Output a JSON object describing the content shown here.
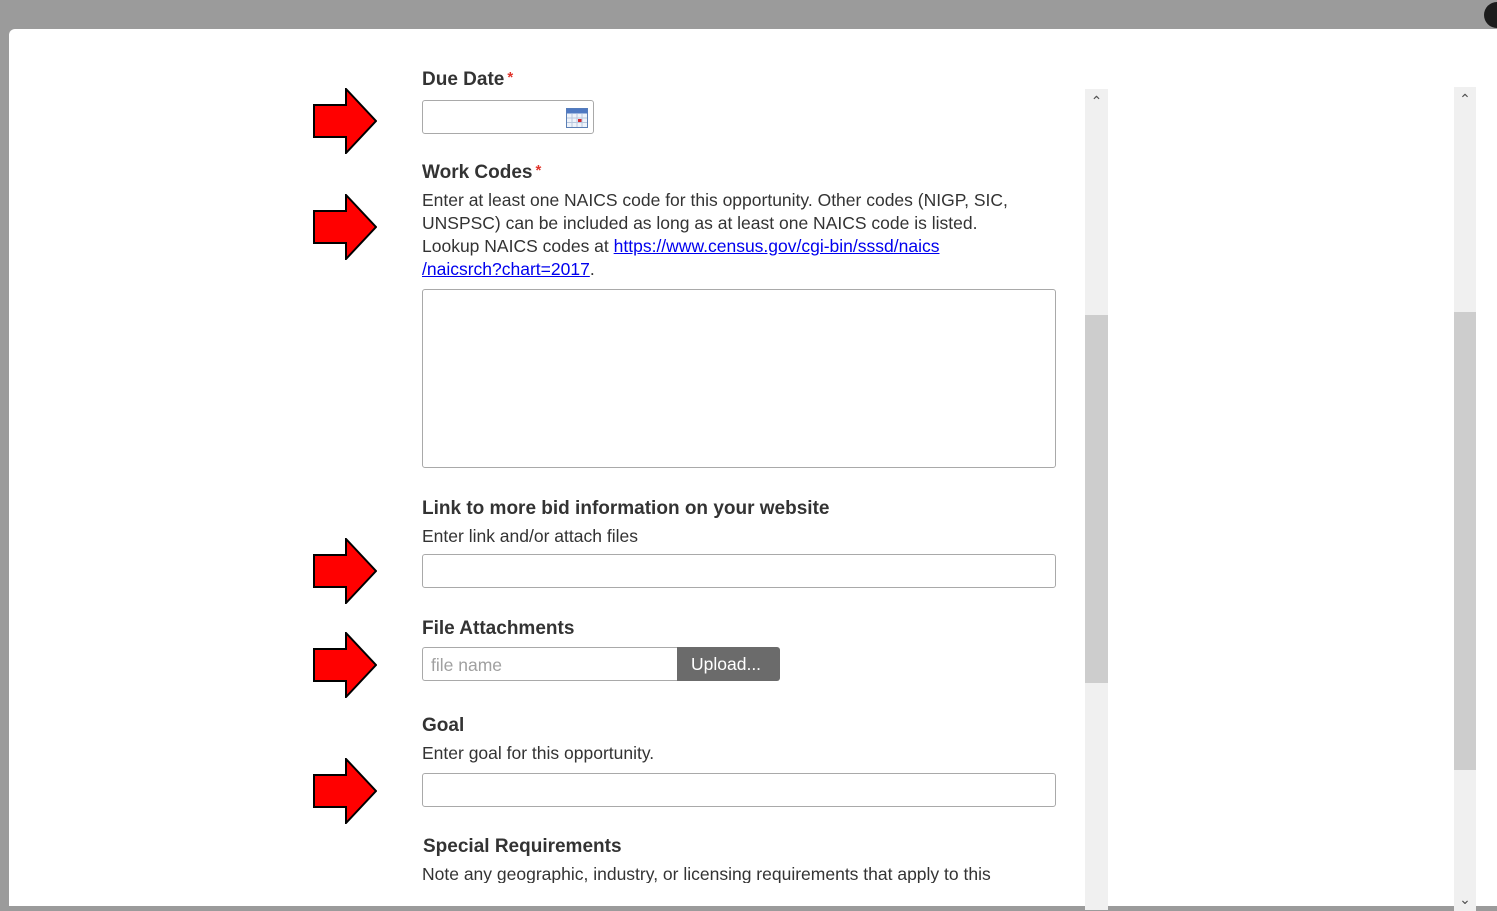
{
  "form": {
    "due_date": {
      "label": "Due Date",
      "required_mark": "*",
      "value": ""
    },
    "work_codes": {
      "label": "Work Codes",
      "required_mark": "*",
      "help_line1": "Enter at least one NAICS code for this opportunity. Other codes (NIGP, SIC,",
      "help_line2": "UNSPSC) can be included as long as at least one NAICS code is listed.",
      "help_line3_prefix": "Lookup NAICS codes at ",
      "link_part1": "https://www.census.gov/cgi-bin/sssd/naics",
      "link_part2": "/naicsrch?chart=2017",
      "help_suffix": ".",
      "value": ""
    },
    "bid_link": {
      "label": "Link to more bid information on your website",
      "help": "Enter link and/or attach files",
      "value": ""
    },
    "file_attachments": {
      "label": "File Attachments",
      "placeholder": "file name",
      "upload_label": "Upload..."
    },
    "goal": {
      "label": "Goal",
      "help": "Enter goal for this opportunity.",
      "value": ""
    },
    "special_requirements": {
      "label": "Special Requirements",
      "help": "Note any geographic, industry, or licensing requirements that apply to this"
    }
  },
  "icons": {
    "calendar": "calendar-icon",
    "arrow": "red-arrow-annotation-icon",
    "scroll_up": "chevron-up-icon",
    "scroll_down": "chevron-down-icon"
  },
  "colors": {
    "required": "#e0342b",
    "annotation_arrow": "#ff0000",
    "upload_button": "#6b6b6b",
    "link": "#0000ee",
    "backdrop": "#9b9b9b"
  },
  "scrollbars": {
    "inner_scroll_fraction": 0.32,
    "outer_scroll_fraction": 0.31
  }
}
